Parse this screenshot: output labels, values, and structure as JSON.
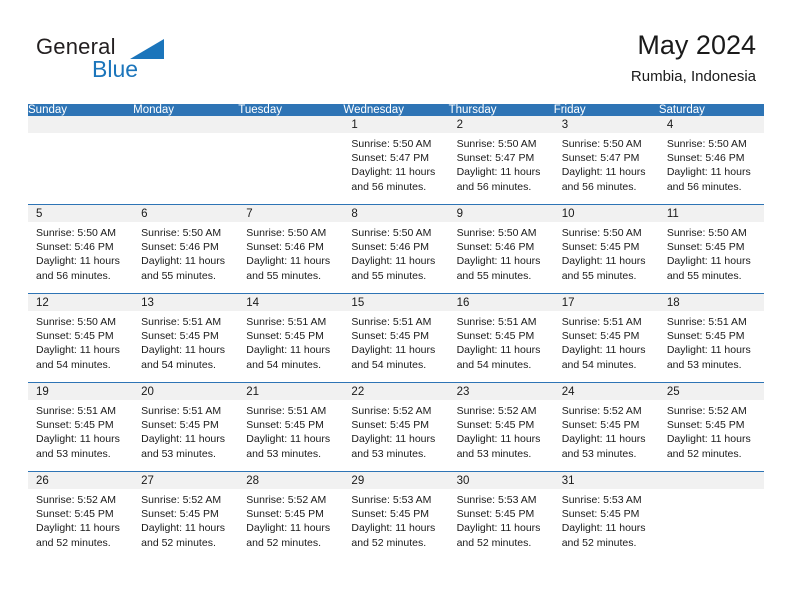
{
  "brand": {
    "name_part1": "General",
    "name_part2": "Blue",
    "triangle_icon": "triangle-icon",
    "accent_color": "#1b75bb"
  },
  "header": {
    "title": "May 2024",
    "subtitle": "Rumbia, Indonesia"
  },
  "calendar": {
    "header_bg": "#2e74b5",
    "daynum_bg": "#f1f1f1",
    "weekday_headers": [
      "Sunday",
      "Monday",
      "Tuesday",
      "Wednesday",
      "Thursday",
      "Friday",
      "Saturday"
    ],
    "weeks": [
      [
        {
          "day": "",
          "sunrise": "",
          "sunset": "",
          "daylight1": "",
          "daylight2": ""
        },
        {
          "day": "",
          "sunrise": "",
          "sunset": "",
          "daylight1": "",
          "daylight2": ""
        },
        {
          "day": "",
          "sunrise": "",
          "sunset": "",
          "daylight1": "",
          "daylight2": ""
        },
        {
          "day": "1",
          "sunrise": "Sunrise: 5:50 AM",
          "sunset": "Sunset: 5:47 PM",
          "daylight1": "Daylight: 11 hours",
          "daylight2": "and 56 minutes."
        },
        {
          "day": "2",
          "sunrise": "Sunrise: 5:50 AM",
          "sunset": "Sunset: 5:47 PM",
          "daylight1": "Daylight: 11 hours",
          "daylight2": "and 56 minutes."
        },
        {
          "day": "3",
          "sunrise": "Sunrise: 5:50 AM",
          "sunset": "Sunset: 5:47 PM",
          "daylight1": "Daylight: 11 hours",
          "daylight2": "and 56 minutes."
        },
        {
          "day": "4",
          "sunrise": "Sunrise: 5:50 AM",
          "sunset": "Sunset: 5:46 PM",
          "daylight1": "Daylight: 11 hours",
          "daylight2": "and 56 minutes."
        }
      ],
      [
        {
          "day": "5",
          "sunrise": "Sunrise: 5:50 AM",
          "sunset": "Sunset: 5:46 PM",
          "daylight1": "Daylight: 11 hours",
          "daylight2": "and 56 minutes."
        },
        {
          "day": "6",
          "sunrise": "Sunrise: 5:50 AM",
          "sunset": "Sunset: 5:46 PM",
          "daylight1": "Daylight: 11 hours",
          "daylight2": "and 55 minutes."
        },
        {
          "day": "7",
          "sunrise": "Sunrise: 5:50 AM",
          "sunset": "Sunset: 5:46 PM",
          "daylight1": "Daylight: 11 hours",
          "daylight2": "and 55 minutes."
        },
        {
          "day": "8",
          "sunrise": "Sunrise: 5:50 AM",
          "sunset": "Sunset: 5:46 PM",
          "daylight1": "Daylight: 11 hours",
          "daylight2": "and 55 minutes."
        },
        {
          "day": "9",
          "sunrise": "Sunrise: 5:50 AM",
          "sunset": "Sunset: 5:46 PM",
          "daylight1": "Daylight: 11 hours",
          "daylight2": "and 55 minutes."
        },
        {
          "day": "10",
          "sunrise": "Sunrise: 5:50 AM",
          "sunset": "Sunset: 5:45 PM",
          "daylight1": "Daylight: 11 hours",
          "daylight2": "and 55 minutes."
        },
        {
          "day": "11",
          "sunrise": "Sunrise: 5:50 AM",
          "sunset": "Sunset: 5:45 PM",
          "daylight1": "Daylight: 11 hours",
          "daylight2": "and 55 minutes."
        }
      ],
      [
        {
          "day": "12",
          "sunrise": "Sunrise: 5:50 AM",
          "sunset": "Sunset: 5:45 PM",
          "daylight1": "Daylight: 11 hours",
          "daylight2": "and 54 minutes."
        },
        {
          "day": "13",
          "sunrise": "Sunrise: 5:51 AM",
          "sunset": "Sunset: 5:45 PM",
          "daylight1": "Daylight: 11 hours",
          "daylight2": "and 54 minutes."
        },
        {
          "day": "14",
          "sunrise": "Sunrise: 5:51 AM",
          "sunset": "Sunset: 5:45 PM",
          "daylight1": "Daylight: 11 hours",
          "daylight2": "and 54 minutes."
        },
        {
          "day": "15",
          "sunrise": "Sunrise: 5:51 AM",
          "sunset": "Sunset: 5:45 PM",
          "daylight1": "Daylight: 11 hours",
          "daylight2": "and 54 minutes."
        },
        {
          "day": "16",
          "sunrise": "Sunrise: 5:51 AM",
          "sunset": "Sunset: 5:45 PM",
          "daylight1": "Daylight: 11 hours",
          "daylight2": "and 54 minutes."
        },
        {
          "day": "17",
          "sunrise": "Sunrise: 5:51 AM",
          "sunset": "Sunset: 5:45 PM",
          "daylight1": "Daylight: 11 hours",
          "daylight2": "and 54 minutes."
        },
        {
          "day": "18",
          "sunrise": "Sunrise: 5:51 AM",
          "sunset": "Sunset: 5:45 PM",
          "daylight1": "Daylight: 11 hours",
          "daylight2": "and 53 minutes."
        }
      ],
      [
        {
          "day": "19",
          "sunrise": "Sunrise: 5:51 AM",
          "sunset": "Sunset: 5:45 PM",
          "daylight1": "Daylight: 11 hours",
          "daylight2": "and 53 minutes."
        },
        {
          "day": "20",
          "sunrise": "Sunrise: 5:51 AM",
          "sunset": "Sunset: 5:45 PM",
          "daylight1": "Daylight: 11 hours",
          "daylight2": "and 53 minutes."
        },
        {
          "day": "21",
          "sunrise": "Sunrise: 5:51 AM",
          "sunset": "Sunset: 5:45 PM",
          "daylight1": "Daylight: 11 hours",
          "daylight2": "and 53 minutes."
        },
        {
          "day": "22",
          "sunrise": "Sunrise: 5:52 AM",
          "sunset": "Sunset: 5:45 PM",
          "daylight1": "Daylight: 11 hours",
          "daylight2": "and 53 minutes."
        },
        {
          "day": "23",
          "sunrise": "Sunrise: 5:52 AM",
          "sunset": "Sunset: 5:45 PM",
          "daylight1": "Daylight: 11 hours",
          "daylight2": "and 53 minutes."
        },
        {
          "day": "24",
          "sunrise": "Sunrise: 5:52 AM",
          "sunset": "Sunset: 5:45 PM",
          "daylight1": "Daylight: 11 hours",
          "daylight2": "and 53 minutes."
        },
        {
          "day": "25",
          "sunrise": "Sunrise: 5:52 AM",
          "sunset": "Sunset: 5:45 PM",
          "daylight1": "Daylight: 11 hours",
          "daylight2": "and 52 minutes."
        }
      ],
      [
        {
          "day": "26",
          "sunrise": "Sunrise: 5:52 AM",
          "sunset": "Sunset: 5:45 PM",
          "daylight1": "Daylight: 11 hours",
          "daylight2": "and 52 minutes."
        },
        {
          "day": "27",
          "sunrise": "Sunrise: 5:52 AM",
          "sunset": "Sunset: 5:45 PM",
          "daylight1": "Daylight: 11 hours",
          "daylight2": "and 52 minutes."
        },
        {
          "day": "28",
          "sunrise": "Sunrise: 5:52 AM",
          "sunset": "Sunset: 5:45 PM",
          "daylight1": "Daylight: 11 hours",
          "daylight2": "and 52 minutes."
        },
        {
          "day": "29",
          "sunrise": "Sunrise: 5:53 AM",
          "sunset": "Sunset: 5:45 PM",
          "daylight1": "Daylight: 11 hours",
          "daylight2": "and 52 minutes."
        },
        {
          "day": "30",
          "sunrise": "Sunrise: 5:53 AM",
          "sunset": "Sunset: 5:45 PM",
          "daylight1": "Daylight: 11 hours",
          "daylight2": "and 52 minutes."
        },
        {
          "day": "31",
          "sunrise": "Sunrise: 5:53 AM",
          "sunset": "Sunset: 5:45 PM",
          "daylight1": "Daylight: 11 hours",
          "daylight2": "and 52 minutes."
        },
        {
          "day": "",
          "sunrise": "",
          "sunset": "",
          "daylight1": "",
          "daylight2": ""
        }
      ]
    ]
  }
}
